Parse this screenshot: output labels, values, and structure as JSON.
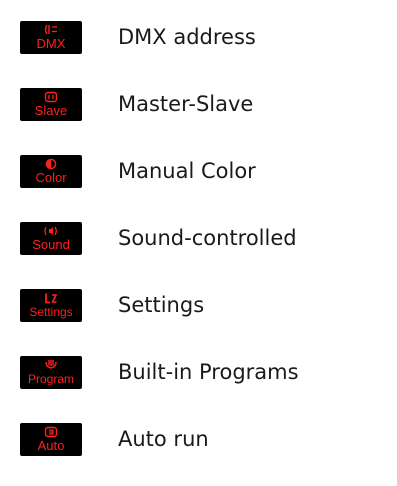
{
  "colors": {
    "badge_background": "#000000",
    "badge_text": "#ff1f1f",
    "label_text": "#1a1a1a"
  },
  "modes": [
    {
      "badge": "DMX",
      "icon": "dmx-icon",
      "label": "DMX address"
    },
    {
      "badge": "Slave",
      "icon": "master-slave-icon",
      "label": "Master-Slave"
    },
    {
      "badge": "Color",
      "icon": "color-icon",
      "label": "Manual Color"
    },
    {
      "badge": "Sound",
      "icon": "sound-icon",
      "label": "Sound-controlled"
    },
    {
      "badge": "Settings",
      "icon": "settings-icon",
      "label": "Settings"
    },
    {
      "badge": "Program",
      "icon": "program-icon",
      "label": "Built-in Programs"
    },
    {
      "badge": "Auto",
      "icon": "auto-icon",
      "label": "Auto run"
    }
  ]
}
